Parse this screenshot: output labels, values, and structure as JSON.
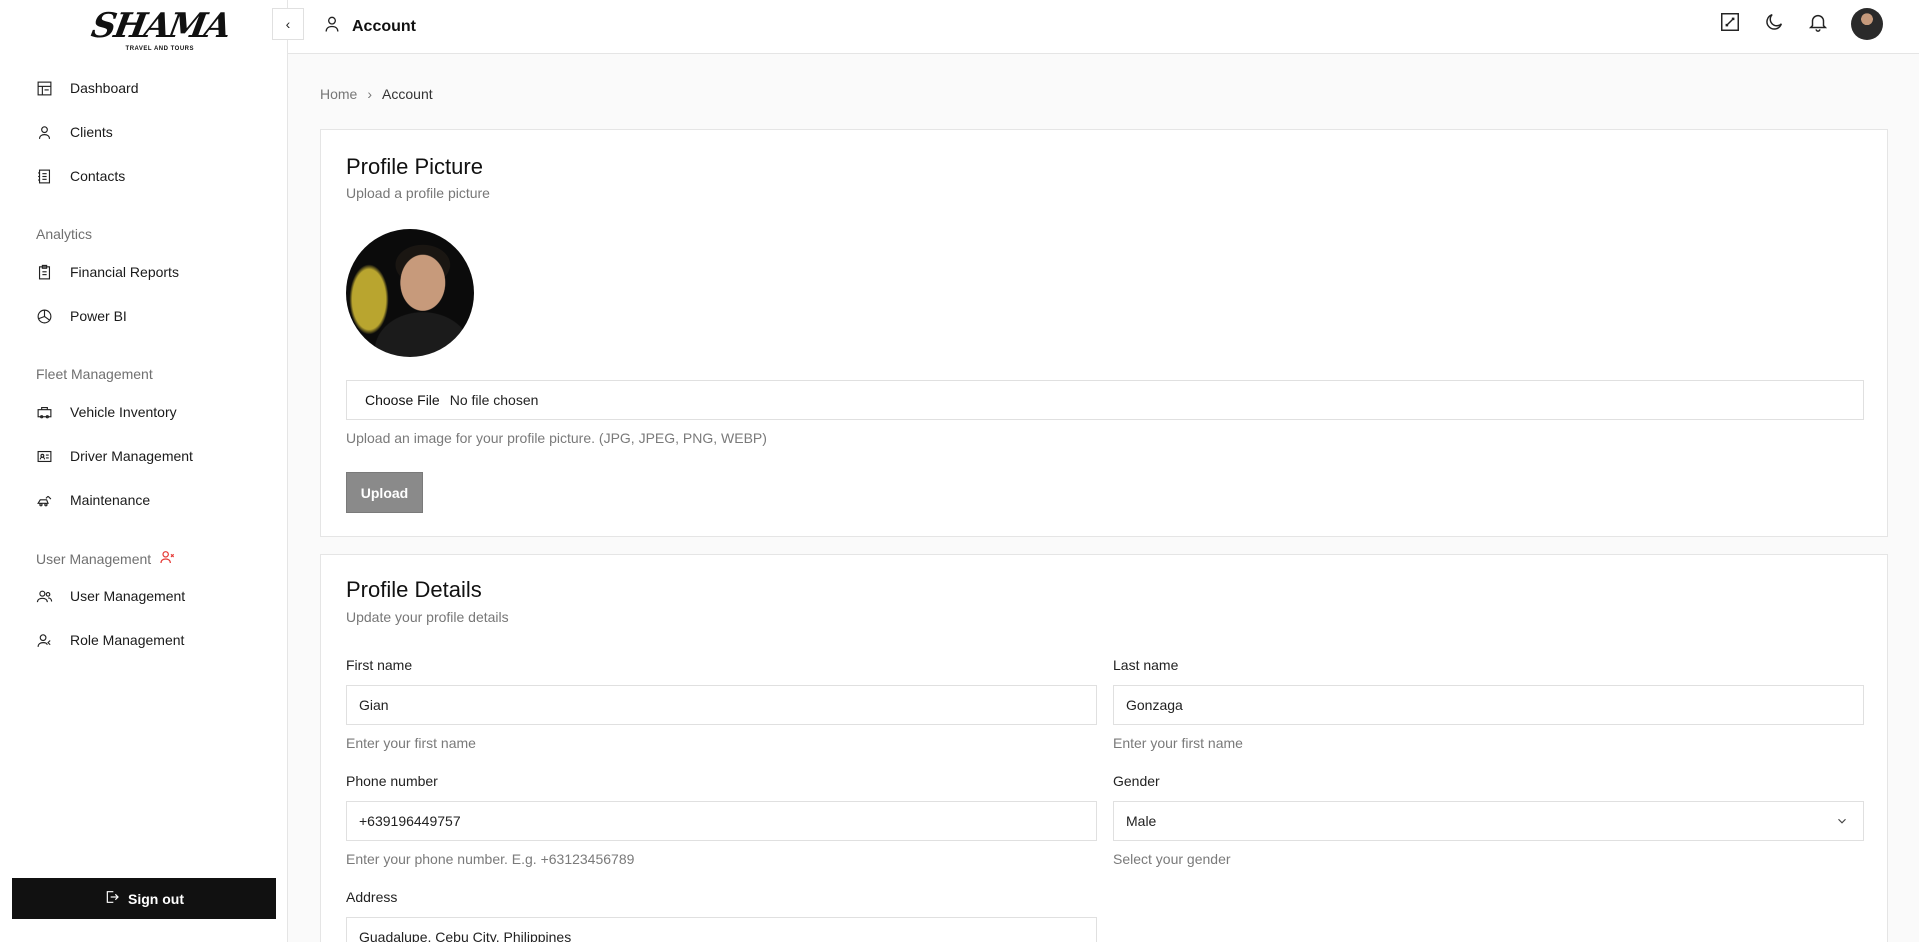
{
  "brand": {
    "name": "SHAMA",
    "tagline": "TRAVEL AND TOURS"
  },
  "sidebar": {
    "main_items": [
      {
        "label": "Dashboard",
        "icon": "dashboard-icon"
      },
      {
        "label": "Clients",
        "icon": "user-icon"
      },
      {
        "label": "Contacts",
        "icon": "contacts-icon"
      }
    ],
    "analytics": {
      "title": "Analytics",
      "items": [
        {
          "label": "Financial Reports",
          "icon": "clipboard-icon"
        },
        {
          "label": "Power BI",
          "icon": "chart-pie-icon"
        }
      ]
    },
    "fleet": {
      "title": "Fleet Management",
      "items": [
        {
          "label": "Vehicle Inventory",
          "icon": "car-icon"
        },
        {
          "label": "Driver Management",
          "icon": "id-card-icon"
        },
        {
          "label": "Maintenance",
          "icon": "wrench-car-icon"
        }
      ]
    },
    "users": {
      "title": "User Management",
      "items": [
        {
          "label": "User Management",
          "icon": "users-icon"
        },
        {
          "label": "Role Management",
          "icon": "user-role-icon"
        }
      ]
    },
    "signout_label": "Sign out"
  },
  "header": {
    "title": "Account"
  },
  "breadcrumb": {
    "home": "Home",
    "separator": "›",
    "current": "Account"
  },
  "profile_picture": {
    "title": "Profile Picture",
    "subtitle": "Upload a profile picture",
    "choose_label": "Choose File",
    "file_status": "No file chosen",
    "hint": "Upload an image for your profile picture. (JPG, JPEG, PNG, WEBP)",
    "upload_label": "Upload"
  },
  "profile_details": {
    "title": "Profile Details",
    "subtitle": "Update your profile details",
    "first_name": {
      "label": "First name",
      "value": "Gian",
      "hint": "Enter your first name"
    },
    "last_name": {
      "label": "Last name",
      "value": "Gonzaga",
      "hint": "Enter your first name"
    },
    "phone": {
      "label": "Phone number",
      "value": "+639196449757",
      "hint": "Enter your phone number. E.g. +63123456789"
    },
    "gender": {
      "label": "Gender",
      "value": "Male",
      "hint": "Select your gender"
    },
    "address": {
      "label": "Address",
      "value": "Guadalupe, Cebu City, Philippines"
    }
  },
  "colors": {
    "sidebar_bg": "#ffffff",
    "signout_bg": "#111111",
    "upload_disabled_bg": "#8a8a8a",
    "accent_red": "#e53935"
  }
}
